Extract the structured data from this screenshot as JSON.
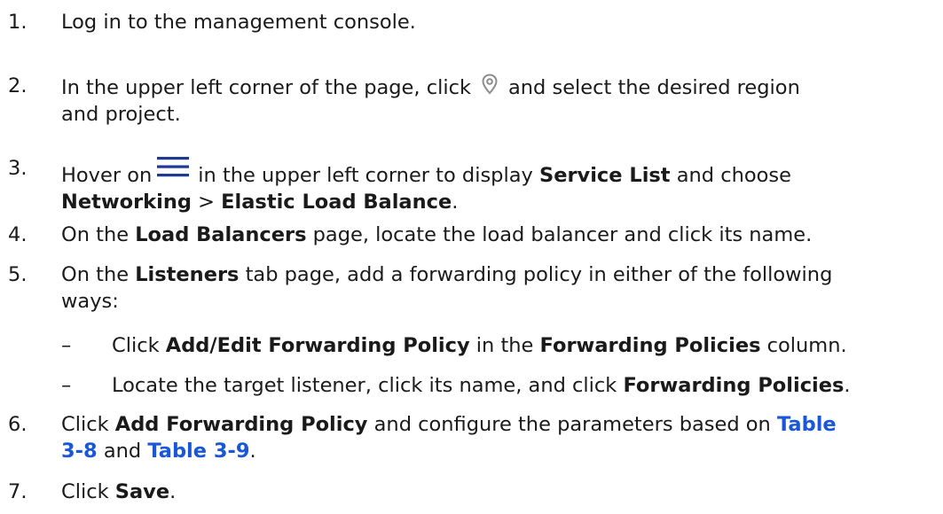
{
  "steps": [
    {
      "num": "1.",
      "text": "Log in to the management console."
    },
    {
      "num": "2.",
      "a": "In the upper left corner of the page, click",
      "b": "and select the desired region",
      "c": "and project.",
      "icon": "location-pin-icon"
    },
    {
      "num": "3.",
      "a": "Hover on",
      "b": "in the upper left corner to display",
      "b_bold": "Service List",
      "c": "and choose",
      "d_bold": "Networking",
      "e": ">",
      "f_bold": "Elastic Load Balance",
      "g": ".",
      "icon": "menu-icon"
    },
    {
      "num": "4.",
      "a": "On the",
      "b_bold": "Load Balancers",
      "c": "page, locate the load balancer and click its name."
    },
    {
      "num": "5.",
      "a": "On the",
      "b_bold": "Listeners",
      "c": "tab page, add a forwarding policy in either of the following",
      "d": "ways:"
    },
    {
      "num": "6.",
      "a": "Click",
      "b_bold": "Add Forwarding Policy",
      "c": "and configure the parameters based on",
      "link1a": "Table",
      "link1b": "3-8",
      "d": "and",
      "link2": "Table 3-9",
      "e": "."
    },
    {
      "num": "7.",
      "a": "Click",
      "b_bold": "Save",
      "c": "."
    }
  ],
  "substeps": [
    {
      "dash": "–",
      "a": "Click",
      "b_bold": "Add/Edit Forwarding Policy",
      "c": "in the",
      "d_bold": "Forwarding Policies",
      "e": "column."
    },
    {
      "dash": "–",
      "a": "Locate the target listener, click its name, and click",
      "b_bold": "Forwarding Policies",
      "c": "."
    }
  ],
  "colors": {
    "text": "#1a1a1a",
    "link": "#1a57d6",
    "icon": "#8c8c8c"
  }
}
